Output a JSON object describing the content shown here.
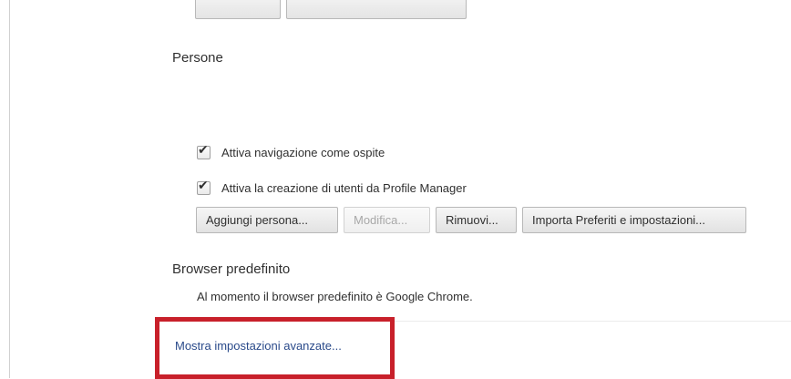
{
  "sections": {
    "people": {
      "title": "Persone",
      "checkboxes": [
        {
          "label": "Attiva navigazione come ospite",
          "checked": true
        },
        {
          "label": "Attiva la creazione di utenti da Profile Manager",
          "checked": true
        }
      ],
      "buttons": [
        {
          "label": "Aggiungi persona...",
          "enabled": true
        },
        {
          "label": "Modifica...",
          "enabled": false
        },
        {
          "label": "Rimuovi...",
          "enabled": true
        },
        {
          "label": "Importa Preferiti e impostazioni...",
          "enabled": true
        }
      ]
    },
    "default_browser": {
      "title": "Browser predefinito",
      "status_text": "Al momento il browser predefinito è Google Chrome."
    }
  },
  "advanced_link": "Mostra impostazioni avanzate...",
  "colors": {
    "link": "#2a4a8a",
    "highlight": "#c8202a",
    "text": "#303030"
  },
  "icons": {
    "checkbox_check": "checkmark-icon"
  }
}
